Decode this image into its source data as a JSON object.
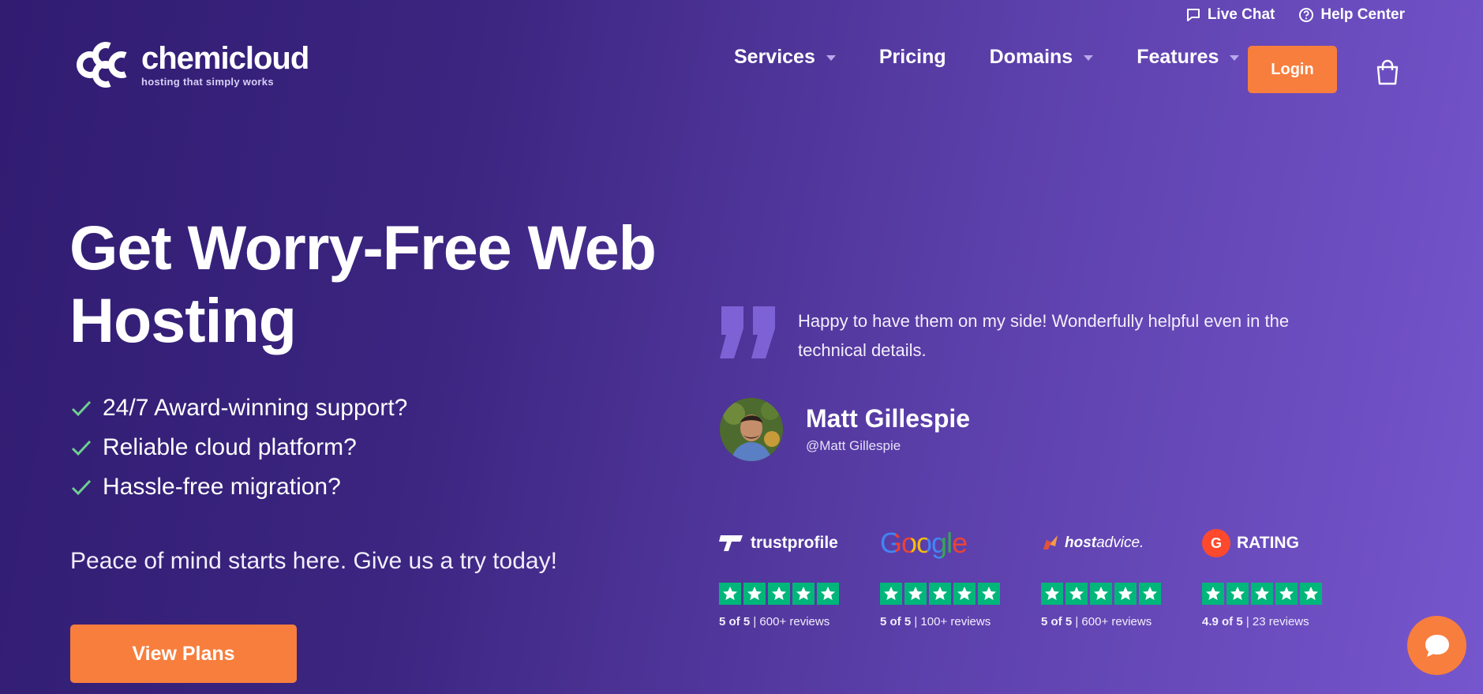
{
  "topbar": {
    "live_chat": "Live Chat",
    "help_center": "Help Center"
  },
  "logo": {
    "name": "chemicloud",
    "tagline": "hosting that simply works"
  },
  "nav": [
    {
      "label": "Services",
      "dropdown": true
    },
    {
      "label": "Pricing",
      "dropdown": false
    },
    {
      "label": "Domains",
      "dropdown": true
    },
    {
      "label": "Features",
      "dropdown": true
    }
  ],
  "login_label": "Login",
  "hero": {
    "title_line1": "Get Worry-Free Web",
    "title_line2": "Hosting",
    "checks": [
      "24/7 Award-winning support?",
      "Reliable cloud platform?",
      "Hassle-free migration?"
    ],
    "subtitle": "Peace of mind starts here. Give us a try today!",
    "cta": "View Plans"
  },
  "testimonial": {
    "quote": "Happy to have them on my side! Wonderfully helpful even in the technical details.",
    "author": "Matt Gillespie",
    "handle": "@Matt Gillespie"
  },
  "reviews": [
    {
      "brand": "trustprofile",
      "score": "5 of 5",
      "count": "600+ reviews",
      "stars": 5
    },
    {
      "brand": "Google",
      "score": "5 of 5",
      "count": "100+ reviews",
      "stars": 5
    },
    {
      "brand_bold": "host",
      "brand_rest": "advice.",
      "score": "5 of 5",
      "count": "600+ reviews",
      "stars": 5
    },
    {
      "brand": "RATING",
      "score": "4.9 of 5",
      "count": "23 reviews",
      "stars": 5
    }
  ],
  "colors": {
    "accent": "#f77e3d",
    "star_green": "#00b67a",
    "check_green": "#6fcf8f",
    "bg_dark": "#311c72",
    "bg_light": "#7656cd"
  },
  "icons": [
    "chat-icon",
    "help-circle-icon",
    "caret-down-icon",
    "cart-icon",
    "check-icon",
    "quote-icon",
    "star-icon",
    "chat-bubble-icon"
  ]
}
